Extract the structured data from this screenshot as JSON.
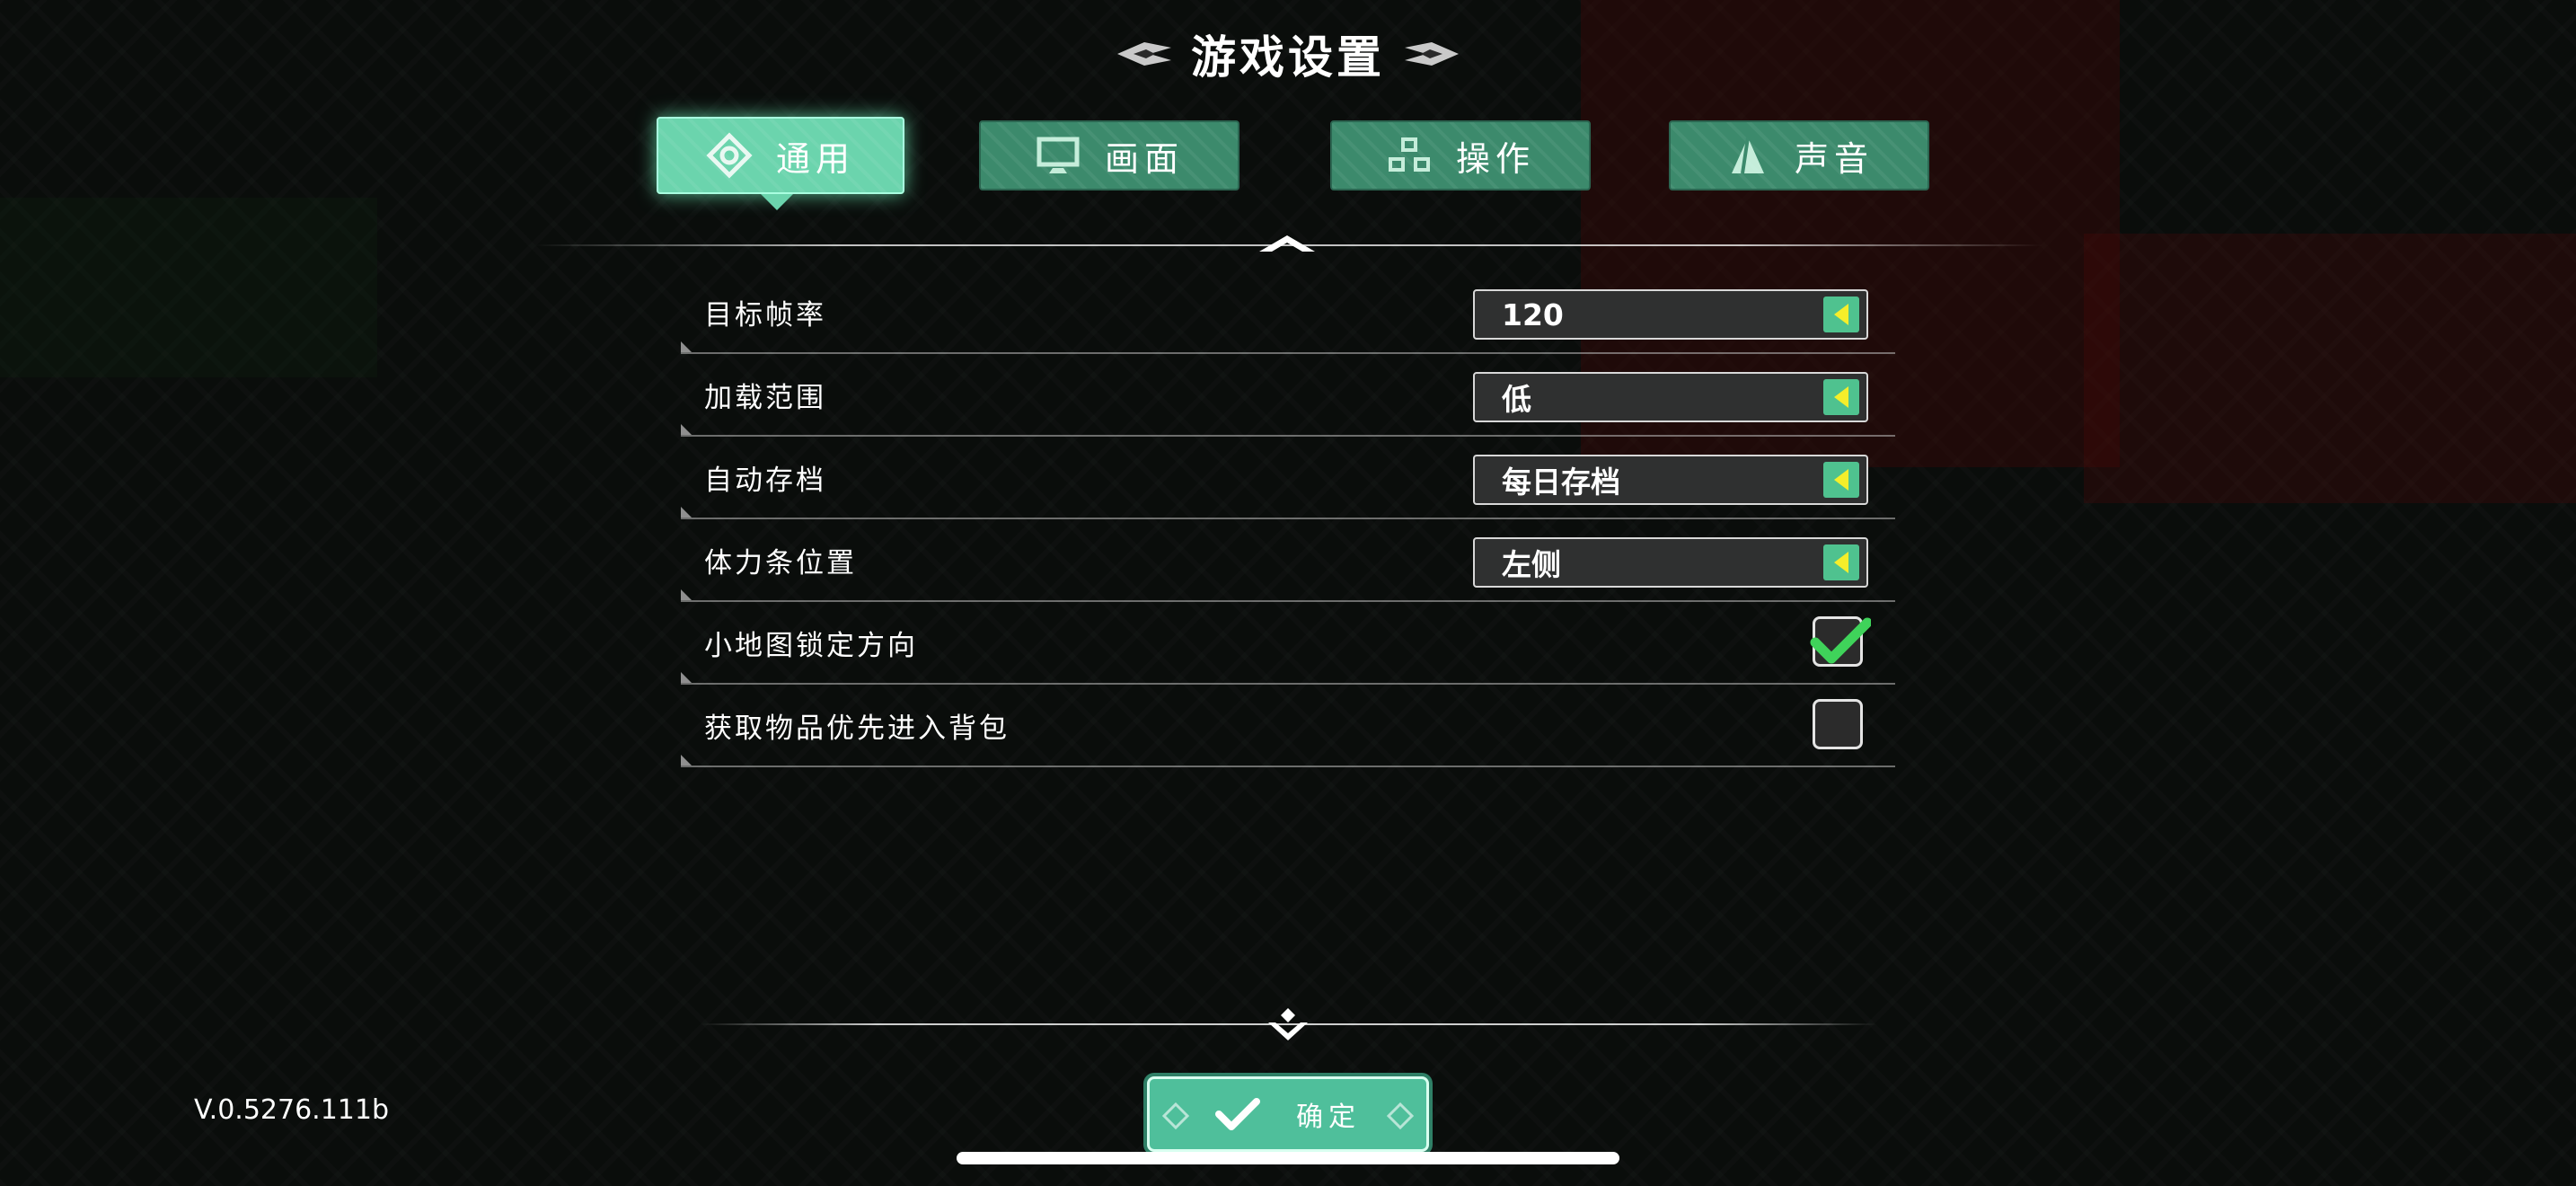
{
  "title": "游戏设置",
  "tabs": [
    {
      "label": "通用",
      "icon": "general-icon",
      "active": true
    },
    {
      "label": "画面",
      "icon": "display-icon",
      "active": false
    },
    {
      "label": "操作",
      "icon": "controls-icon",
      "active": false
    },
    {
      "label": "声音",
      "icon": "sound-icon",
      "active": false
    }
  ],
  "settings": [
    {
      "label": "目标帧率",
      "type": "select",
      "value": "120"
    },
    {
      "label": "加载范围",
      "type": "select",
      "value": "低"
    },
    {
      "label": "自动存档",
      "type": "select",
      "value": "每日存档"
    },
    {
      "label": "体力条位置",
      "type": "select",
      "value": "左侧"
    },
    {
      "label": "小地图锁定方向",
      "type": "checkbox",
      "checked": true
    },
    {
      "label": "获取物品优先进入背包",
      "type": "checkbox",
      "checked": false
    }
  ],
  "confirm_label": "确定",
  "version": "V.0.5276.111b",
  "colors": {
    "tab": "#3c8a6c",
    "tab_active": "#6bd4ad",
    "select_arrow_bg": "#4fc28f",
    "select_arrow": "#f5ee2a",
    "check": "#3fd35a",
    "confirm": "#4fbf9b"
  }
}
